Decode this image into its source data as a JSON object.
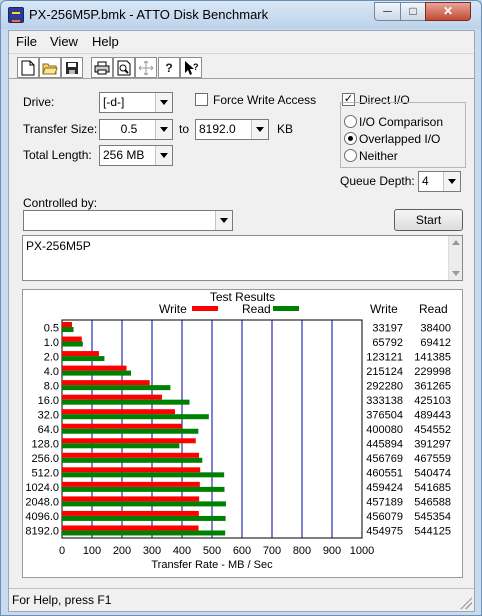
{
  "window": {
    "title": "PX-256M5P.bmk - ATTO Disk Benchmark",
    "minimize": "─",
    "maximize": "□",
    "close": "✕"
  },
  "menu": {
    "file": "File",
    "view": "View",
    "help": "Help"
  },
  "toolbar": {
    "icons": [
      "new-icon",
      "open-icon",
      "save-icon",
      "print-icon",
      "print-preview-icon",
      "move-icon",
      "help-icon",
      "context-help-icon"
    ]
  },
  "form": {
    "drive_label": "Drive:",
    "drive_value": "[-d-]",
    "force_write_label": "Force Write Access",
    "force_write_checked": false,
    "direct_io_label": "Direct I/O",
    "direct_io_checked": true,
    "transfer_label": "Transfer Size:",
    "transfer_from": "0.5",
    "transfer_to_word": "to",
    "transfer_to": "8192.0",
    "transfer_unit": "KB",
    "total_length_label": "Total Length:",
    "total_length_value": "256 MB",
    "io_mode": {
      "options": [
        "I/O Comparison",
        "Overlapped I/O",
        "Neither"
      ],
      "selected": "Overlapped I/O"
    },
    "queue_depth_label": "Queue Depth:",
    "queue_depth_value": "4",
    "controlled_by_label": "Controlled by:",
    "controlled_by_value": "",
    "start_button": "Start",
    "notes_text": "PX-256M5P"
  },
  "results": {
    "title": "Test Results",
    "legend_write": "Write",
    "legend_read": "Read",
    "col_write": "Write",
    "col_read": "Read",
    "write_color": "#ff0000",
    "read_color": "#008000",
    "grid_color": "#0000a0"
  },
  "chart_data": {
    "type": "bar",
    "orientation": "horizontal",
    "categories": [
      "0.5",
      "1.0",
      "2.0",
      "4.0",
      "8.0",
      "16.0",
      "32.0",
      "64.0",
      "128.0",
      "256.0",
      "512.0",
      "1024.0",
      "2048.0",
      "4096.0",
      "8192.0"
    ],
    "series": [
      {
        "name": "Write",
        "values": [
          33197,
          65792,
          123121,
          215124,
          292280,
          333138,
          376504,
          400080,
          445894,
          456769,
          460551,
          459424,
          457189,
          456079,
          454975
        ]
      },
      {
        "name": "Read",
        "values": [
          38400,
          69412,
          141385,
          229998,
          361265,
          425103,
          489443,
          454552,
          391297,
          467559,
          540474,
          541685,
          546588,
          545354,
          544125
        ]
      }
    ],
    "xlabel": "Transfer Rate - MB / Sec",
    "xlim": [
      0,
      1000
    ],
    "xticks": [
      "0",
      "100",
      "200",
      "300",
      "400",
      "500",
      "600",
      "700",
      "800",
      "900",
      "1000"
    ],
    "grid": true,
    "legend": "top"
  },
  "status": {
    "text": "For Help, press F1"
  }
}
